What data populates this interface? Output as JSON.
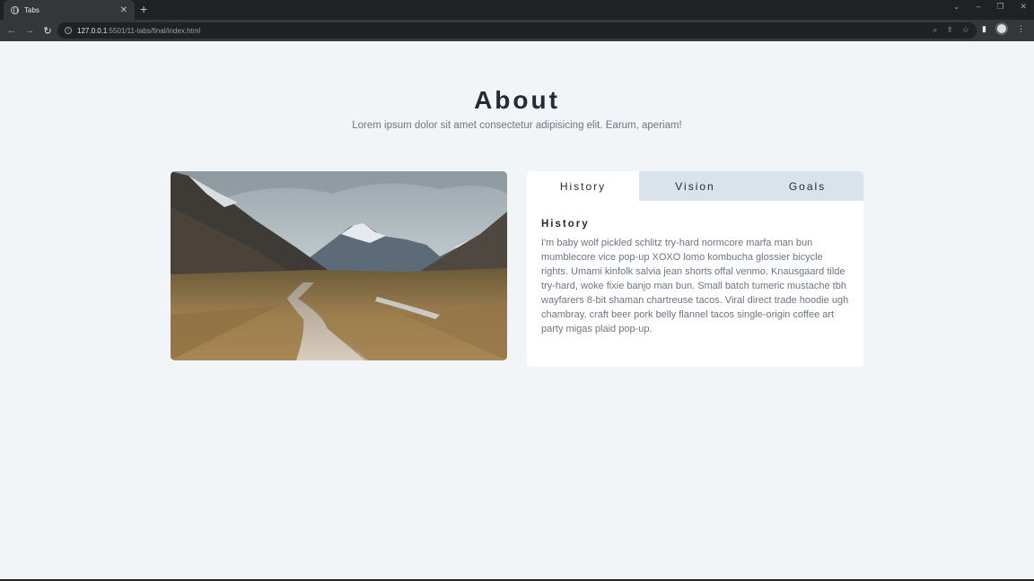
{
  "browser": {
    "tab_title": "Tabs",
    "tab_close": "✕",
    "new_tab": "+",
    "url_host": "127.0.0.1",
    "url_rest": ":5501/11-tabs/final/index.html",
    "window_controls": [
      "⌄",
      "–",
      "❐",
      "✕"
    ]
  },
  "page": {
    "title": "About",
    "subtitle": "Lorem ipsum dolor sit amet consectetur adipisicing elit. Earum, aperiam!",
    "image_alt": "mountain landscape with wooden boardwalk"
  },
  "tabs": [
    {
      "label": "History",
      "active": true
    },
    {
      "label": "Vision",
      "active": false
    },
    {
      "label": "Goals",
      "active": false
    }
  ],
  "content": {
    "heading": "History",
    "body": "I'm baby wolf pickled schlitz try-hard normcore marfa man bun mumblecore vice pop-up XOXO lomo kombucha glossier bicycle rights. Umami kinfolk salvia jean shorts offal venmo. Knausgaard tilde try-hard, woke fixie banjo man bun. Small batch tumeric mustache tbh wayfarers 8-bit shaman chartreuse tacos. Viral direct trade hoodie ugh chambray, craft beer pork belly flannel tacos single-origin coffee art party migas plaid pop-up."
  },
  "icons": {
    "back": "back-arrow-icon",
    "forward": "forward-arrow-icon",
    "reload": "reload-icon",
    "info": "site-info-icon",
    "zoom": "zoom-icon",
    "share": "share-icon",
    "bookmark": "star-icon",
    "sidepanel": "side-panel-icon",
    "profile": "profile-avatar",
    "menu": "kebab-menu-icon"
  },
  "colors": {
    "page_bg": "#f1f5f8",
    "tab_inactive_bg": "#dae2ec",
    "heading": "#222c36",
    "muted_text": "#6c7580"
  }
}
